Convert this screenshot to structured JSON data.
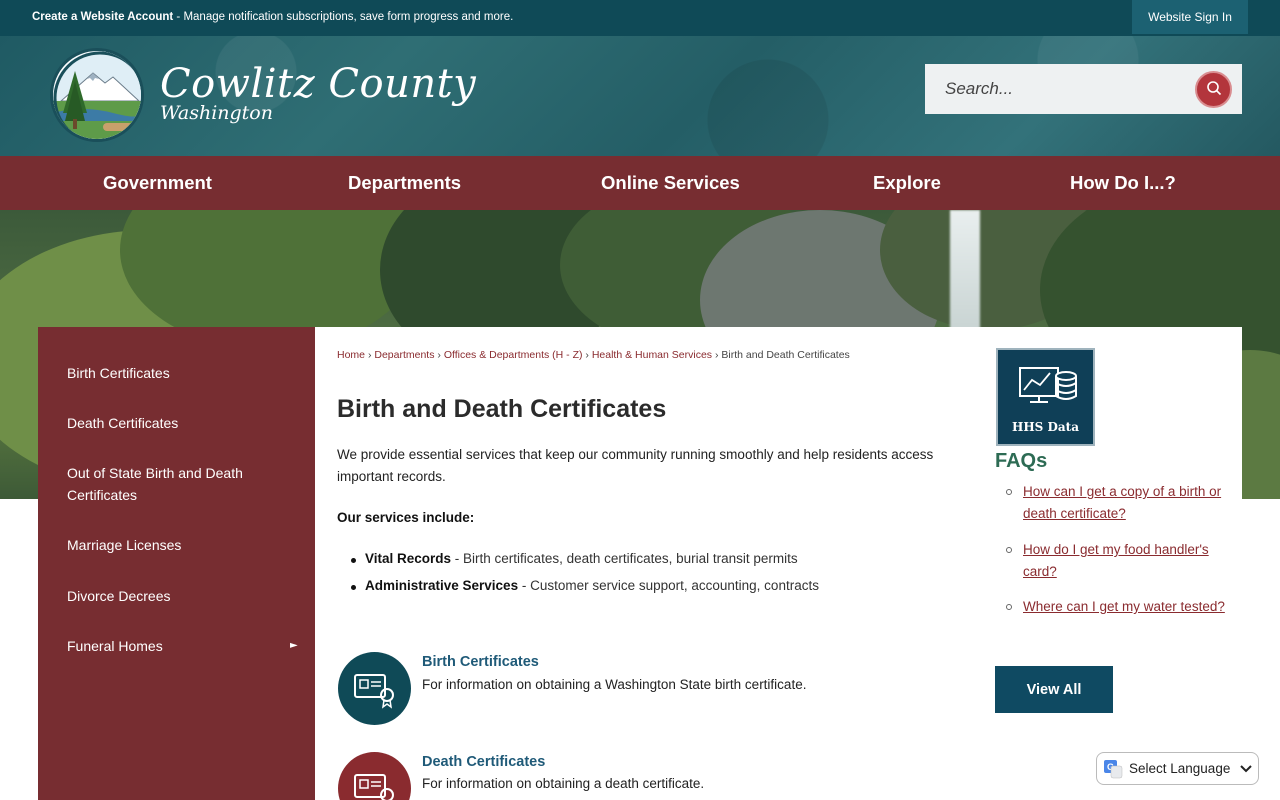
{
  "topbar": {
    "create_account": "Create a Website Account",
    "create_account_desc": " - Manage notification subscriptions, save form progress and more.",
    "sign_in": "Website Sign In"
  },
  "header": {
    "site_name": "Cowlitz County",
    "state": "Washington",
    "search_placeholder": "Search..."
  },
  "nav": {
    "items": [
      "Government",
      "Departments",
      "Online Services",
      "Explore",
      "How Do I...?"
    ]
  },
  "sidebar": {
    "items": [
      "Birth Certificates",
      "Death Certificates",
      "Out of State Birth and Death Certificates",
      "Marriage Licenses",
      "Divorce Decrees",
      "Funeral Homes"
    ]
  },
  "breadcrumb": {
    "items": [
      "Home",
      "Departments",
      "Offices & Departments (H - Z)",
      "Health & Human Services"
    ],
    "current": "Birth and Death Certificates",
    "separator": "›"
  },
  "main": {
    "title": "Birth and Death Certificates",
    "intro": "We provide essential services that keep our community running smoothly and help residents access important records.",
    "services_heading": "Our services include:",
    "services": [
      {
        "name": "Vital Records",
        "desc": " - Birth certificates, death certificates, burial transit permits"
      },
      {
        "name": "Administrative Services",
        "desc": " - Customer service support, accounting, contracts"
      }
    ],
    "cards": [
      {
        "title": "Birth Certificates",
        "desc": "For information on obtaining a Washington State birth certificate.",
        "color": "#0f4a57"
      },
      {
        "title": "Death Certificates",
        "desc": "For information on obtaining a death certificate.",
        "color": "#8a2b2f"
      }
    ]
  },
  "right": {
    "hhs_label": "HHS Data",
    "faq_title": "FAQs",
    "faqs": [
      "How can I get a copy of a birth or death certificate?",
      "How do I get my food handler's card?",
      "Where can I get my water tested?"
    ],
    "view_all": "View All"
  },
  "translate": {
    "label": "Select Language"
  },
  "colors": {
    "topbar": "#0f4a57",
    "nav": "#772d31",
    "sidebar": "#772d31",
    "link": "#8a2b2f",
    "faq_title": "#2d6b54",
    "button": "#0f4a62"
  }
}
